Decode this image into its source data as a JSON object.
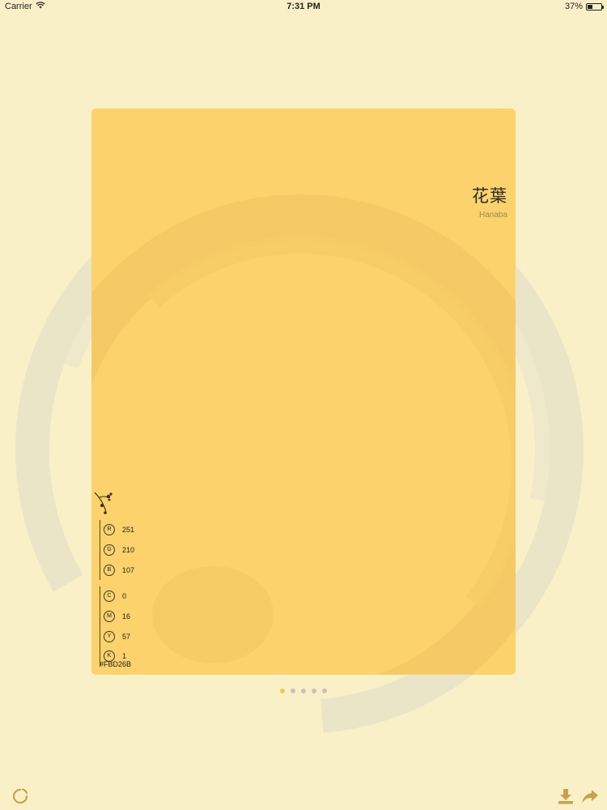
{
  "status_bar": {
    "carrier": "Carrier",
    "time": "7:31 PM",
    "battery": "37%",
    "battery_level": 0.37
  },
  "colors": {
    "background": "#FAF0C8",
    "card": "#FBD26B",
    "accent": "#C9A24A",
    "active_dot": "#F2C94C"
  },
  "color_card": {
    "kanji": "花葉",
    "romaji": "Hanaba",
    "rgb": [
      {
        "label": "R",
        "value": "251"
      },
      {
        "label": "G",
        "value": "210"
      },
      {
        "label": "B",
        "value": "107"
      }
    ],
    "cmyk": [
      {
        "label": "C",
        "value": "0"
      },
      {
        "label": "M",
        "value": "16"
      },
      {
        "label": "Y",
        "value": "57"
      },
      {
        "label": "K",
        "value": "1"
      }
    ],
    "hex": "#FBD26B"
  },
  "pager": {
    "total": 5,
    "current": 1
  },
  "toolbar": {
    "left_icon": "refresh-circle-icon",
    "download_icon": "download-icon",
    "share_icon": "share-icon"
  }
}
